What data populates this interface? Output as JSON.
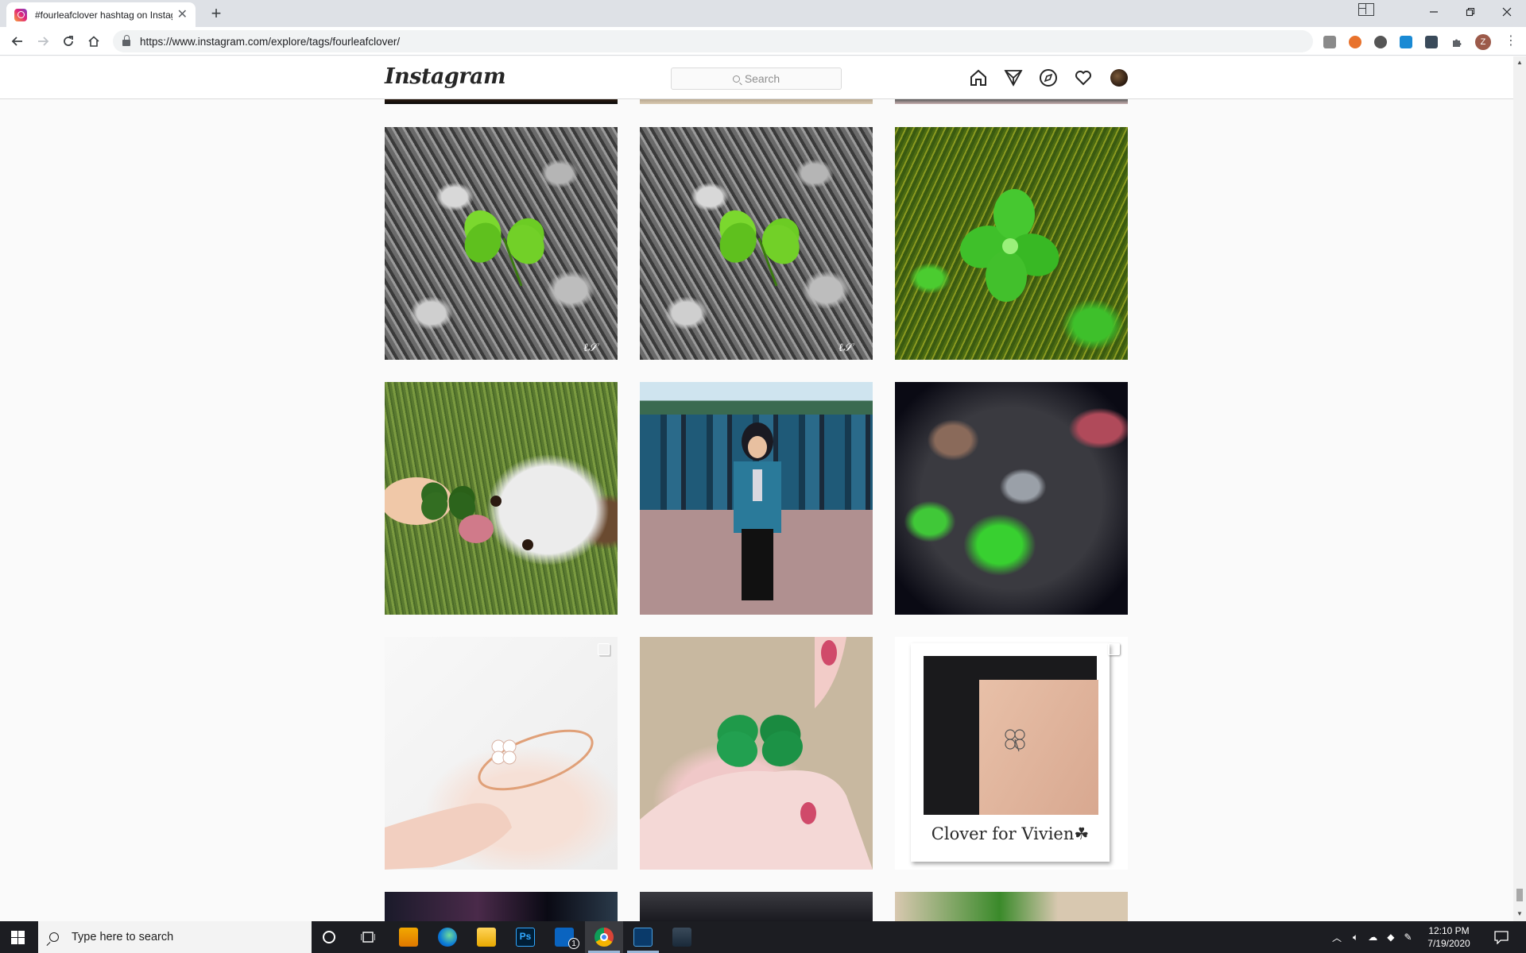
{
  "browser": {
    "tab_title": "#fourleafclover hashtag on Instagram",
    "url": "https://www.instagram.com/explore/tags/fourleafclover/",
    "profile_initial": "Z"
  },
  "instagram": {
    "logo": "Instagram",
    "search_placeholder": "Search",
    "nav_icons": [
      "home-icon",
      "direct-messages-icon",
      "explore-icon",
      "activity-heart-icon",
      "profile-avatar"
    ]
  },
  "grid": {
    "rows": [
      [
        {
          "name": "post-bw-clover-1",
          "desc": "four leaf clover on black and white background",
          "multi": false
        },
        {
          "name": "post-bw-clover-2",
          "desc": "four leaf clover on black and white background",
          "multi": false
        },
        {
          "name": "post-green-clover",
          "desc": "green clover in grass",
          "multi": false
        }
      ],
      [
        {
          "name": "post-dog-clover",
          "desc": "dog with four leaf clover",
          "multi": false
        },
        {
          "name": "post-graduates",
          "desc": "students in blue jackets",
          "multi": false
        },
        {
          "name": "post-rocks-clover",
          "desc": "clovers among rocks",
          "multi": false
        }
      ],
      [
        {
          "name": "post-clover-ring",
          "desc": "clover ring on finger",
          "multi": true
        },
        {
          "name": "post-clover-hand",
          "desc": "clover held in hand",
          "multi": false
        },
        {
          "name": "post-tattoo",
          "desc": "clover tattoo on wrist",
          "multi": true
        }
      ]
    ],
    "tattoo_caption": "Clover for Vivien☘"
  },
  "taskbar": {
    "search_placeholder": "Type here to search",
    "time": "12:10 PM",
    "date": "7/19/2020",
    "mail_badge": "1"
  }
}
